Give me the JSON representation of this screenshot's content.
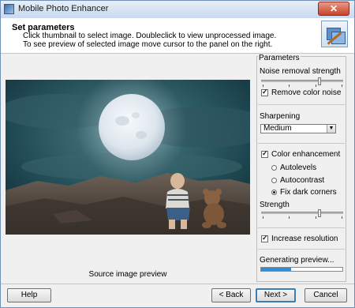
{
  "window": {
    "title": "Mobile Photo Enhancer",
    "close_symbol": "✕"
  },
  "header": {
    "title": "Set parameters",
    "line1": "Click thumbnail to select image. Doubleclick to view unprocessed image.",
    "line2": "To see preview of selected image move cursor to the panel on the right."
  },
  "preview": {
    "caption": "Source image preview"
  },
  "params": {
    "legend": "Parameters",
    "noise_label": "Noise removal strength",
    "noise_level": 0.72,
    "remove_color_noise": {
      "label": "Remove color noise",
      "checked": true
    },
    "sharpening_label": "Sharpening",
    "sharpening_value": "Medium",
    "color_enhancement": {
      "label": "Color enhancement",
      "checked": true
    },
    "radios": [
      {
        "label": "Autolevels",
        "checked": false
      },
      {
        "label": "Autocontrast",
        "checked": false
      },
      {
        "label": "Fix dark corners",
        "checked": true
      }
    ],
    "strength_label": "Strength",
    "strength_level": 0.72,
    "increase_resolution": {
      "label": "Increase resolution",
      "checked": true
    },
    "generating_label": "Generating preview...",
    "progress": 0.37
  },
  "buttons": {
    "help": "Help",
    "back": "< Back",
    "next": "Next >",
    "cancel": "Cancel"
  },
  "colors": {
    "accent": "#2f8ed8",
    "sky": "#1f4f5c",
    "moon": "#e8eef4"
  }
}
